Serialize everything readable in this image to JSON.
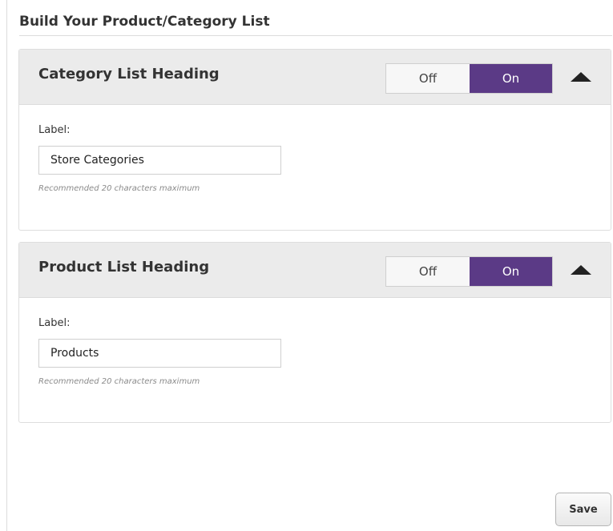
{
  "page": {
    "title": "Build Your Product/Category List"
  },
  "panels": [
    {
      "heading": "Category List Heading",
      "toggle": {
        "off_label": "Off",
        "on_label": "On",
        "state": "On"
      },
      "field_label": "Label:",
      "input_value": "Store Categories",
      "hint": "Recommended 20 characters maximum"
    },
    {
      "heading": "Product List Heading",
      "toggle": {
        "off_label": "Off",
        "on_label": "On",
        "state": "On"
      },
      "field_label": "Label:",
      "input_value": "Products",
      "hint": "Recommended 20 characters maximum"
    }
  ],
  "footer": {
    "save_label": "Save"
  },
  "colors": {
    "accent_on": "#5b3a86",
    "header_bg": "#ebebeb"
  },
  "icons": {
    "collapse": "triangle-up-icon"
  }
}
